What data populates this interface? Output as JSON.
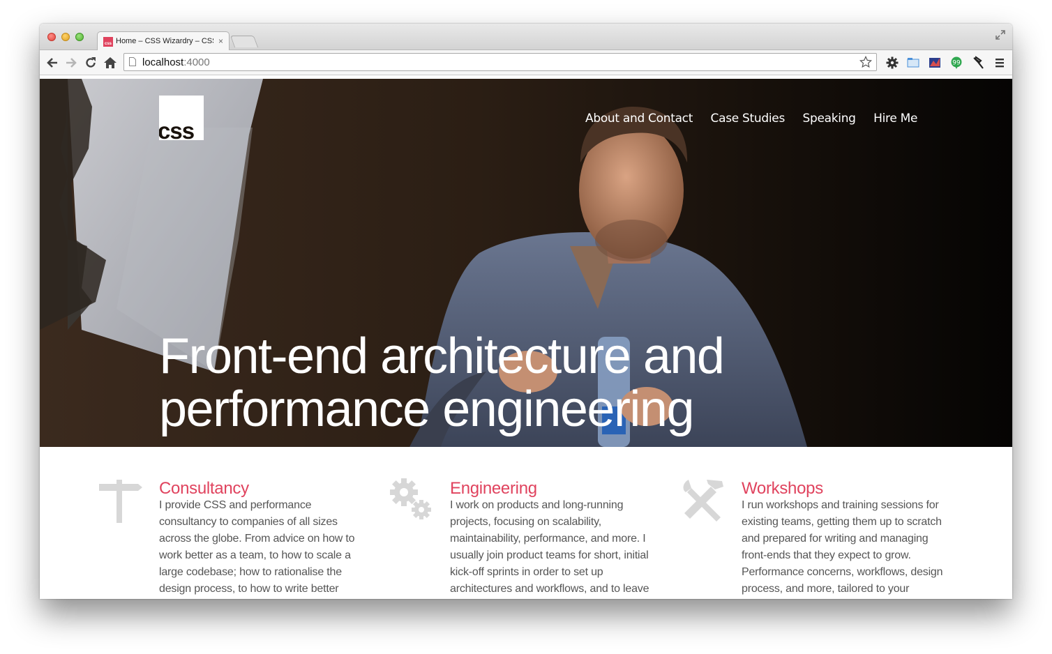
{
  "browser": {
    "tab_title": "Home – CSS Wizardry – CSS",
    "tab_close": "×",
    "favicon_text": "css",
    "url_host": "localhost",
    "url_port": ":4000"
  },
  "site": {
    "logo_text": "css",
    "nav": [
      "About and Contact",
      "Case Studies",
      "Speaking",
      "Hire Me"
    ],
    "headline_line1": "Front-end architecture and",
    "headline_line2": "performance engineering"
  },
  "services": [
    {
      "title": "Consultancy",
      "icon": "signpost-icon",
      "text": "I provide CSS and performance consultancy to companies of all sizes across the globe. From advice on how to work better as a team, to how to scale a large codebase; how to rationalise the design process, to how to write better"
    },
    {
      "title": "Engineering",
      "icon": "gears-icon",
      "text": "I work on products and long-running projects, focusing on scalability, maintainability, performance, and more. I usually join product teams for short, initial kick-off sprints in order to set up architectures and workflows, and to leave"
    },
    {
      "title": "Workshops",
      "icon": "tools-icon",
      "text": "I run workshops and training sessions for existing teams, getting them up to scratch and prepared for writing and managing front-ends that they expect to grow. Performance concerns, workflows, design process, and more, tailored to your"
    }
  ],
  "colors": {
    "accent": "#e0435e",
    "body_text": "#555555",
    "icon_gray": "#d7d7d7"
  }
}
